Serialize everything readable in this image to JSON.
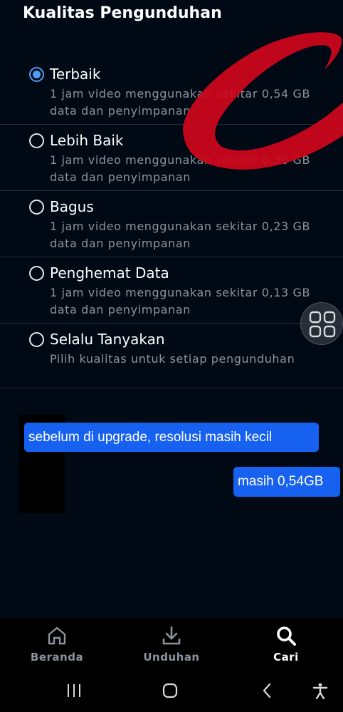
{
  "header": {
    "title": "Kualitas Pengunduhan"
  },
  "options": [
    {
      "label": "Terbaik",
      "description": "1 jam video menggunakan sekitar 0,54 GB data dan penyimpanan",
      "checked": true
    },
    {
      "label": "Lebih Baik",
      "description": "1 jam video menggunakan sekitar 0,30 GB data dan penyimpanan",
      "checked": false
    },
    {
      "label": "Bagus",
      "description": "1 jam video menggunakan sekitar 0,23 GB data dan penyimpanan",
      "checked": false
    },
    {
      "label": "Penghemat Data",
      "description": "1 jam video menggunakan sekitar 0,13 GB data dan penyimpanan",
      "checked": false
    },
    {
      "label": "Selalu Tanyakan",
      "description": "Pilih kualitas untuk setiap pengunduhan",
      "checked": false
    }
  ],
  "annotations": {
    "bubble_1": "sebelum di upgrade, resolusi masih kecil",
    "bubble_2": "masih 0,54GB"
  },
  "bottom_nav": {
    "items": [
      {
        "label": "Beranda",
        "icon": "home-icon",
        "active": false
      },
      {
        "label": "Unduhan",
        "icon": "download-icon",
        "active": false
      },
      {
        "label": "Cari",
        "icon": "search-icon",
        "active": true
      }
    ]
  },
  "system_nav": {
    "icons": [
      "recent-apps-icon",
      "home-circle-icon",
      "back-icon",
      "accessibility-icon"
    ]
  },
  "colors": {
    "background": "#000914",
    "accent": "#4f9cf5",
    "annotation_red": "#d0071c",
    "bubble_blue": "#1761f0",
    "muted_text": "#8c939d"
  }
}
